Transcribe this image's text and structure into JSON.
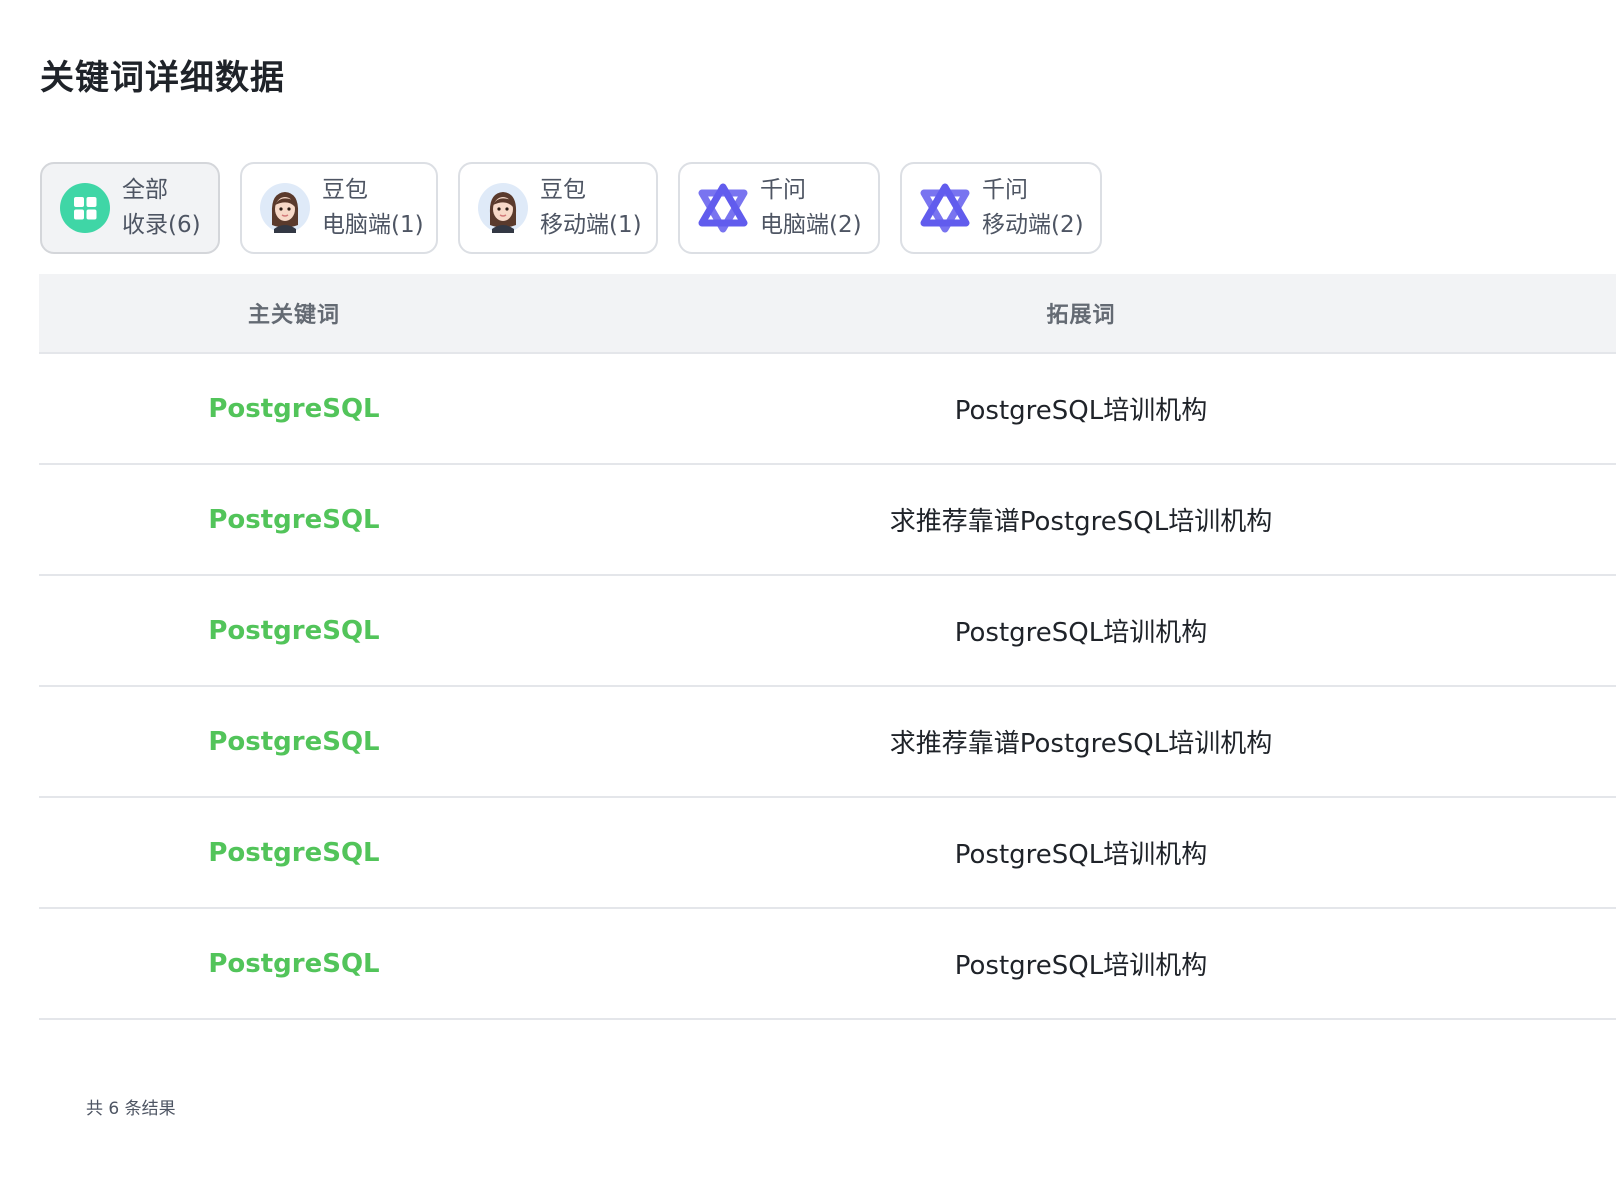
{
  "page": {
    "title": "关键词详细数据"
  },
  "filters": [
    {
      "line1": "全部",
      "line2": "收录(6)",
      "icon": "grid-icon",
      "active": true
    },
    {
      "line1": "豆包",
      "line2": "电脑端(1)",
      "icon": "doubao-avatar-icon",
      "active": false
    },
    {
      "line1": "豆包",
      "line2": "移动端(1)",
      "icon": "doubao-avatar-icon",
      "active": false
    },
    {
      "line1": "千问",
      "line2": "电脑端(2)",
      "icon": "qianwen-logo-icon",
      "active": false
    },
    {
      "line1": "千问",
      "line2": "移动端(2)",
      "icon": "qianwen-logo-icon",
      "active": false
    }
  ],
  "table": {
    "headers": {
      "main": "主关键词",
      "ext": "拓展词"
    },
    "rows": [
      {
        "main": "PostgreSQL",
        "ext": "PostgreSQL培训机构"
      },
      {
        "main": "PostgreSQL",
        "ext": "求推荐靠谱PostgreSQL培训机构"
      },
      {
        "main": "PostgreSQL",
        "ext": "PostgreSQL培训机构"
      },
      {
        "main": "PostgreSQL",
        "ext": "求推荐靠谱PostgreSQL培训机构"
      },
      {
        "main": "PostgreSQL",
        "ext": "PostgreSQL培训机构"
      },
      {
        "main": "PostgreSQL",
        "ext": "PostgreSQL培训机构"
      }
    ]
  },
  "footer": {
    "total_text": "共 6 条结果"
  },
  "colors": {
    "main_keyword": "#52c45a",
    "grid_icon_bg": "#3fd6a6",
    "qianwen_logo": "#615ced"
  }
}
